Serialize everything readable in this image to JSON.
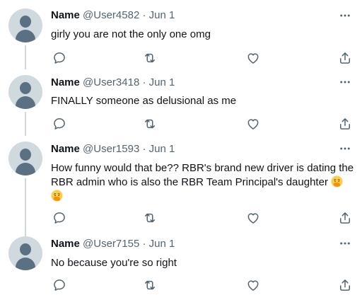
{
  "tweets": [
    {
      "name": "Name",
      "handle": "@User4582",
      "separator": "·",
      "date": "Jun 1",
      "text": "girly you are not the only one omg"
    },
    {
      "name": "Name",
      "handle": "@User3418",
      "separator": "·",
      "date": "Jun 1",
      "text": "FINALLY someone as delusional as me"
    },
    {
      "name": "Name",
      "handle": "@User1593",
      "separator": "·",
      "date": "Jun 1",
      "text_line1": "How funny would that be?? RBR's brand new driver is dating the",
      "text_line2": "RBR admin who is also the RBR Team Principal's daughter",
      "emoji": "face-with-hand-over-mouth"
    },
    {
      "name": "Name",
      "handle": "@User7155",
      "separator": "·",
      "date": "Jun 1",
      "text": "No because you're so right"
    }
  ],
  "icons": {
    "reply": "reply-icon",
    "retweet": "retweet-icon",
    "like": "like-icon",
    "share": "share-icon",
    "more": "more-icon"
  },
  "colors": {
    "text": "#0f1419",
    "secondary": "#536471",
    "avatar_bg": "#cfd9de",
    "avatar_fg": "#5b7083"
  }
}
